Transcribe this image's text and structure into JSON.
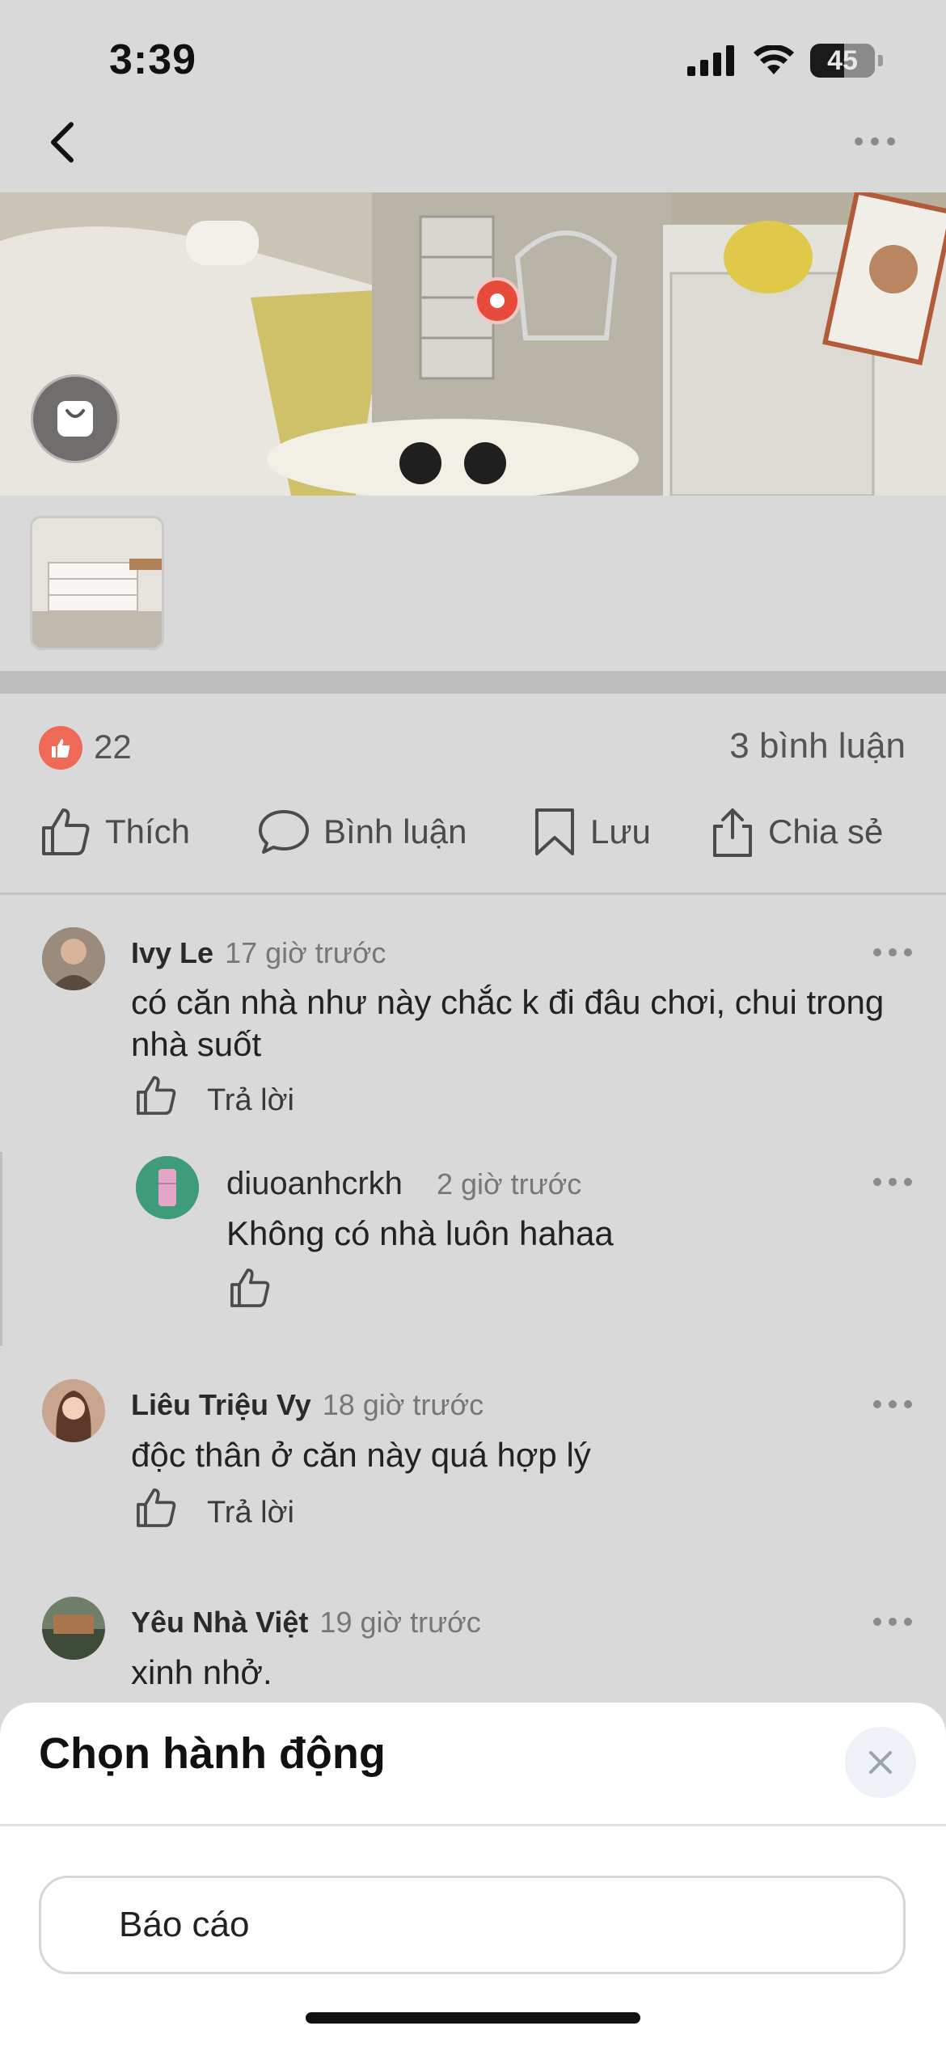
{
  "status_bar": {
    "time": "3:39",
    "battery": "45"
  },
  "post": {
    "like_count": "22",
    "comment_count": "3 bình luận"
  },
  "actions": {
    "like": "Thích",
    "comment": "Bình luận",
    "save": "Lưu",
    "share": "Chia sẻ"
  },
  "comments": [
    {
      "name": "Ivy Le",
      "time": "17 giờ trước",
      "text_line1": "có căn nhà như này chắc k đi đâu chơi, chui trong",
      "text_line2": "nhà suốt",
      "reply_label": "Trả lời"
    },
    {
      "name": "diuoanhcrkh",
      "time": "2 giờ trước",
      "text": "Không có nhà luôn hahaa"
    },
    {
      "name": "Liêu Triệu Vy",
      "time": "18 giờ trước",
      "text": "độc thân ở căn này quá hợp lý",
      "reply_label": "Trả lời"
    },
    {
      "name": "Yêu Nhà Việt",
      "time": "19 giờ trước",
      "text": "xinh nhở."
    }
  ],
  "sheet": {
    "title": "Chọn hành động",
    "option": "Báo cáo"
  },
  "colors": {
    "background": "#d9d9d9",
    "like_badge": "#ee6a57",
    "pin": "#e64b3c",
    "sheet": "#ffffff"
  },
  "icons": [
    "signal-icon",
    "wifi-icon",
    "battery-icon",
    "back-chevron-icon",
    "more-dots-icon",
    "shopping-bag-icon",
    "thumbs-up-icon",
    "comment-bubble-icon",
    "bookmark-icon",
    "share-icon",
    "close-icon"
  ]
}
